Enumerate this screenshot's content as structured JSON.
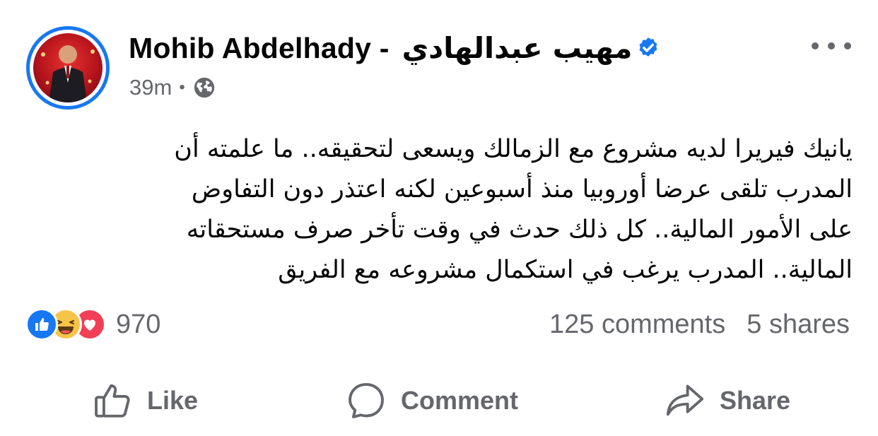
{
  "post": {
    "author": {
      "name_latin": "Mohib Abdelhady -",
      "name_arabic": "مهيب عبدالهادي",
      "verified": true
    },
    "time": "39m",
    "privacy_icon": "globe-icon",
    "body": "يانيك فيريرا لديه مشروع مع الزمالك ويسعى لتحقيقه.. ما علمته أن\nالمدرب تلقى عرضا أوروبيا منذ أسبوعين لكنه اعتذر دون التفاوض\nعلى الأمور المالية.. كل ذلك حدث في وقت تأخر صرف مستحقاته\nالمالية.. المدرب يرغب في استكمال مشروعه مع الفريق",
    "reactions": {
      "types": [
        "like",
        "haha",
        "love"
      ],
      "count": "970"
    },
    "comments": "125 comments",
    "shares": "5 shares",
    "actions": {
      "like": "Like",
      "comment": "Comment",
      "share": "Share"
    }
  },
  "colors": {
    "brand_blue": "#1877f2",
    "secondary_text": "#65676b",
    "love_red": "#f33e58",
    "haha_yellow": "#f7c44a"
  }
}
